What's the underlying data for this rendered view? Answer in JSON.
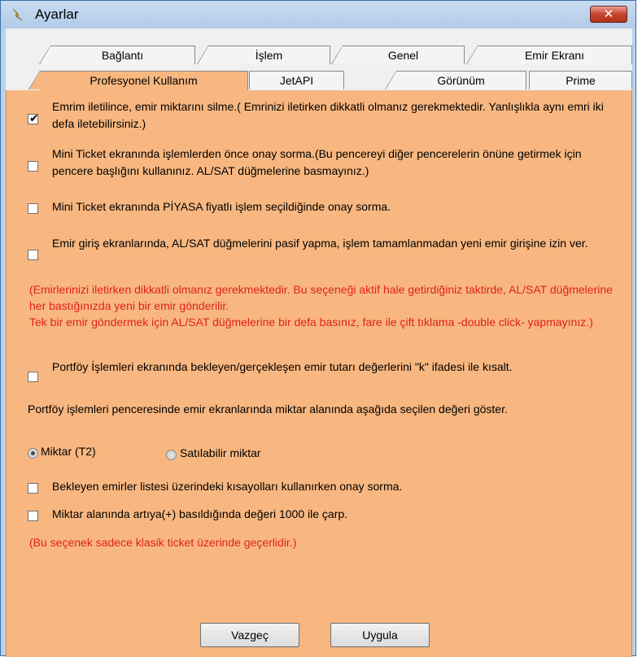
{
  "window": {
    "title": "Ayarlar",
    "close_glyph": "✕"
  },
  "tabs": {
    "row1": [
      {
        "label": "Bağlantı"
      },
      {
        "label": "İşlem"
      },
      {
        "label": "Genel"
      },
      {
        "label": "Emir Ekranı"
      }
    ],
    "row2": [
      {
        "label": "Profesyonel Kullanım",
        "active": true
      },
      {
        "label": "JetAPI"
      },
      {
        "label": "Görünüm"
      },
      {
        "label": "Prime"
      }
    ]
  },
  "options": {
    "opt1": {
      "checked": true,
      "text": "Emrim iletilince, emir miktarını silme.( Emrinizi iletirken dikkatli olmanız gerekmektedir. Yanlışlıkla aynı emri iki defa iletebilirsiniz.)"
    },
    "opt2": {
      "checked": false,
      "text": "Mini Ticket ekranında işlemlerden önce onay sorma.(Bu pencereyi diğer pencerelerin önüne getirmek için pencere başlığını kullanınız. AL/SAT düğmelerine basmayınız.)"
    },
    "opt3": {
      "checked": false,
      "text": "Mini Ticket ekranında PİYASA fiyatlı işlem seçildiğinde onay sorma."
    },
    "opt4": {
      "checked": false,
      "text": "Emir giriş ekranlarında, AL/SAT düğmelerini pasif yapma, işlem tamamlanmadan yeni emir girişine izin ver.",
      "warning_line1": "(Emirlerinizi iletirken dikkatli olmanız gerekmektedir. Bu seçeneği aktif hale getirdiğiniz taktirde, AL/SAT düğmelerine her bastığınızda yeni bir emir gönderilir.",
      "warning_line2": " Tek bir emir göndermek için AL/SAT düğmelerine bir defa basınız, fare ile çift tıklama -double click- yapmayınız.)"
    },
    "opt5": {
      "checked": false,
      "text": "Portföy İşlemleri ekranında bekleyen/gerçekleşen emir tutarı değerlerini \"k\" ifadesi ile kısalt."
    },
    "portfoy_label": "Portföy işlemleri penceresinde emir ekranlarında miktar alanında aşağıda seçilen değeri göster.",
    "radio1": {
      "selected": true,
      "label": "Miktar (T2)"
    },
    "radio2": {
      "selected": false,
      "label": "Satılabilir miktar"
    },
    "opt6": {
      "checked": false,
      "text": "Bekleyen emirler listesi üzerindeki kısayolları kullanırken onay sorma."
    },
    "opt7": {
      "checked": false,
      "text": "Miktar alanında artıya(+) basıldığında değeri 1000 ile çarp.",
      "note": "(Bu seçenek sadece klasik ticket üzerinde geçerlidir.)"
    }
  },
  "buttons": {
    "cancel": "Vazgeç",
    "apply": "Uygula"
  },
  "colors": {
    "panel": "#f8b780",
    "warning": "#e0221a",
    "titlebar": "#b9d1ea"
  }
}
